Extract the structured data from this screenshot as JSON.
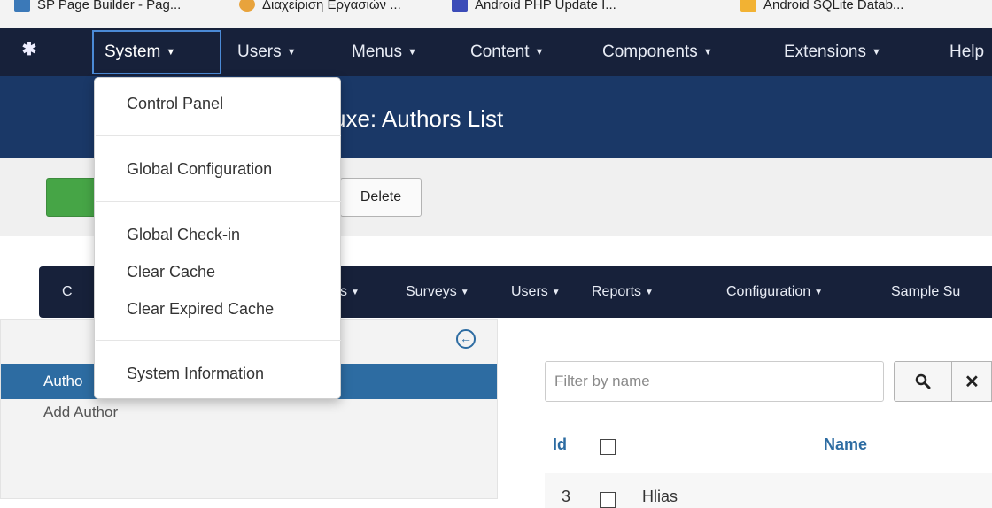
{
  "bookmarks": [
    {
      "label": "SP Page Builder - Pag...",
      "icon": "joomla-icon",
      "color": "#3b79b8"
    },
    {
      "label": "Διαχείριση Εργασιών ...",
      "icon": "bookmark-icon",
      "color": "#e8a33c"
    },
    {
      "label": "Android PHP Update I...",
      "icon": "bookmark-icon",
      "color": "#3b4bb8"
    },
    {
      "label": "Android SQLite Datab...",
      "icon": "bookmark-icon",
      "color": "#f2b233"
    }
  ],
  "navbar": {
    "brand_icon": "joomla-logo-icon",
    "items": [
      "System",
      "Users",
      "Menus",
      "Content",
      "Components",
      "Extensions",
      "Help"
    ]
  },
  "page_title": "uxe: Authors List",
  "toolbar": {
    "delete_label": "Delete"
  },
  "submenu": {
    "items": [
      "C",
      "s",
      "Surveys",
      "Users",
      "Reports",
      "Configuration",
      "Sample Su"
    ]
  },
  "sidebar": {
    "items": [
      "Autho",
      "Add Author"
    ]
  },
  "filter": {
    "placeholder": "Filter by name"
  },
  "table": {
    "headers": {
      "id": "Id",
      "name": "Name"
    },
    "rows": [
      {
        "id": "3",
        "name": "Hlias"
      }
    ]
  },
  "dropdown": {
    "items": [
      "Control Panel",
      "Global Configuration",
      "Global Check-in",
      "Clear Cache",
      "Clear Expired Cache",
      "System Information"
    ]
  },
  "colors": {
    "navbar": "#17213a",
    "subhead": "#1a3867",
    "accent": "#2d6ca2",
    "new_button": "#46a546"
  }
}
